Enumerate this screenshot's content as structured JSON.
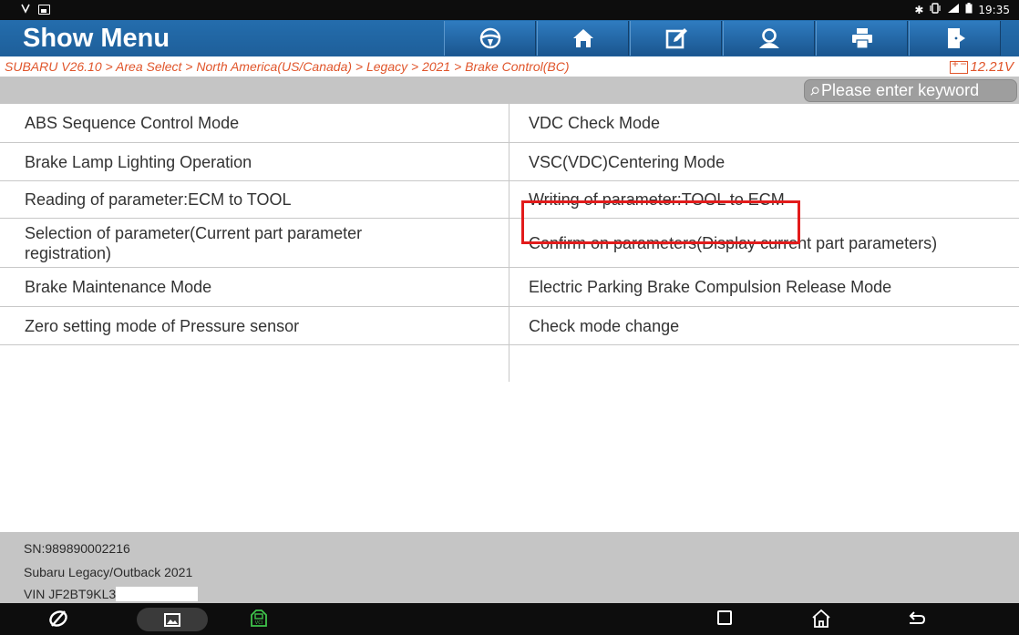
{
  "status_bar": {
    "time": "19:35"
  },
  "header": {
    "title": "Show Menu",
    "toolbar": [
      {
        "name": "steering-wheel-icon"
      },
      {
        "name": "home-icon"
      },
      {
        "name": "edit-icon"
      },
      {
        "name": "user-icon"
      },
      {
        "name": "print-icon"
      },
      {
        "name": "exit-icon"
      }
    ],
    "colors": {
      "header": "#246dad",
      "accent": "#e0552b"
    }
  },
  "breadcrumb": {
    "path": "SUBARU V26.10 > Area Select > North America(US/Canada) > Legacy > 2021 > Brake Control(BC)",
    "voltage": "12.21V"
  },
  "search": {
    "placeholder": "Please enter keyword"
  },
  "menu": {
    "items": [
      {
        "left": "ABS Sequence Control Mode",
        "right": "VDC Check Mode"
      },
      {
        "left": "Brake Lamp Lighting Operation",
        "right": "VSC(VDC)Centering Mode"
      },
      {
        "left": "Reading of parameter:ECM to TOOL",
        "right": "Writing of parameter:TOOL to ECM"
      },
      {
        "left": "Selection of parameter(Current part parameter registration)",
        "right": "Confirm on parameters(Display current part parameters)"
      },
      {
        "left": "Brake Maintenance Mode",
        "right": "Electric Parking Brake Compulsion Release Mode"
      },
      {
        "left": "Zero setting mode of Pressure sensor",
        "right": "Check mode change"
      }
    ],
    "highlighted": "VSC(VDC)Centering Mode",
    "highlight_color": "#e21b1b"
  },
  "footer": {
    "sn": "SN:989890002216",
    "vehicle": "Subaru Legacy/Outback 2021",
    "vin": "VIN JF2BT9KL3"
  },
  "navbar": {
    "buttons": [
      "browser-icon",
      "gallery-icon",
      "vci-icon",
      "recent-apps-icon",
      "home-nav-icon",
      "back-icon"
    ]
  }
}
